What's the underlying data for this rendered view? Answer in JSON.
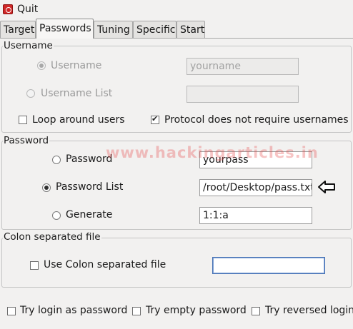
{
  "menu": {
    "quit_label": "Quit"
  },
  "tabs": [
    {
      "label": "Target",
      "active": false
    },
    {
      "label": "Passwords",
      "active": true
    },
    {
      "label": "Tuning",
      "active": false
    },
    {
      "label": "Specific",
      "active": false
    },
    {
      "label": "Start",
      "active": false
    }
  ],
  "username": {
    "title": "Username",
    "username_option": {
      "label": "Username",
      "selected": true,
      "enabled": false
    },
    "username_field": {
      "value": "yourname",
      "enabled": false
    },
    "username_list_option": {
      "label": "Username List",
      "selected": false,
      "enabled": false
    },
    "username_list_field": {
      "value": "",
      "enabled": false
    },
    "loop_around_users": {
      "label": "Loop around users",
      "checked": false
    },
    "protocol_no_usernames": {
      "label": "Protocol does not require usernames",
      "checked": true
    }
  },
  "password": {
    "title": "Password",
    "password_option": {
      "label": "Password",
      "selected": false
    },
    "password_field": {
      "value": "yourpass"
    },
    "password_list_option": {
      "label": "Password List",
      "selected": true
    },
    "password_list_field": {
      "value": "/root/Desktop/pass.txt"
    },
    "generate_option": {
      "label": "Generate",
      "selected": false
    },
    "generate_field": {
      "value": "1:1:a"
    }
  },
  "colon": {
    "title": "Colon separated file",
    "use_colon_file": {
      "label": "Use Colon separated file",
      "checked": false
    },
    "colon_file_field": {
      "value": ""
    }
  },
  "bottom_options": {
    "try_login_as_password": {
      "label": "Try login as password",
      "checked": false
    },
    "try_empty_password": {
      "label": "Try empty password",
      "checked": false
    },
    "try_reversed_login": {
      "label": "Try reversed login",
      "checked": false
    }
  },
  "watermark": {
    "text": "www.hackingarticles.in"
  },
  "icons": {
    "quit": "quit-icon",
    "annotation_arrow": "left-arrow-icon"
  },
  "colors": {
    "window_bg": "#f2f1f0",
    "watermark": "#e64646",
    "focus_border": "#4a74b5"
  }
}
